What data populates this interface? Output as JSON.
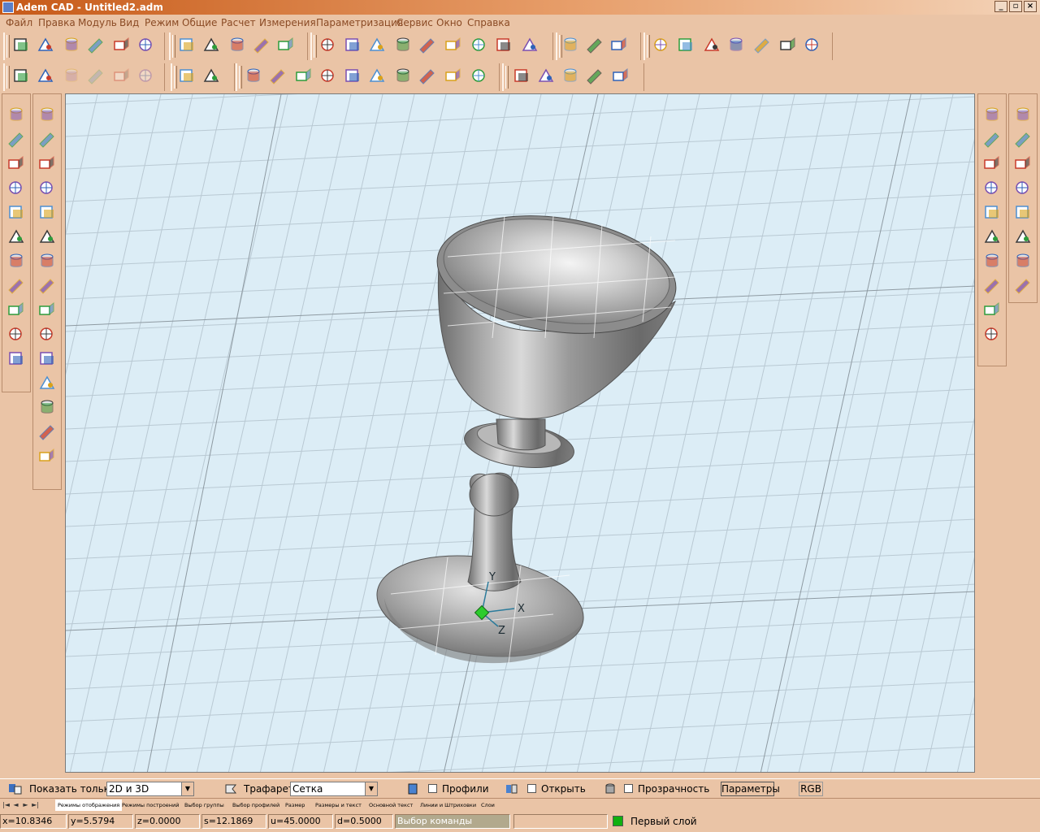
{
  "window": {
    "title": "Adem CAD - Untitled2.adm",
    "controls": [
      "_",
      "▫",
      "×"
    ]
  },
  "menu": [
    "Файл",
    "Правка",
    "Модуль",
    "Вид",
    "Режим",
    "Общие",
    "Расчет",
    "Измерения",
    "Параметризация",
    "Сервис",
    "Окно",
    "Справка"
  ],
  "toolbar1_icons": [
    "new-file-icon",
    "open-folder-icon",
    "save-icon",
    "print-icon",
    "print-preview-icon",
    "copy-files-icon",
    "pencil-sketch-icon",
    "brush-icon",
    "sphere-icon",
    "grid-pattern-icon",
    "hatch-icon",
    "box-solid-icon",
    "box-open-icon",
    "box-pattern-icon",
    "sweep-icon",
    "loft-icon",
    "shell-icon",
    "revolve-icon",
    "chamfer-icon",
    "fillet-icon",
    "cylinder-icon",
    "align-icon",
    "array-icon",
    "import-icon",
    "export-icon",
    "cube-icon",
    "transform-icon",
    "measure-icon",
    "scale-icon",
    "node-grid-icon"
  ],
  "toolbar2_icons": [
    "properties-icon",
    "layers-icon",
    "disabled-save-icon",
    "disabled-tree-icon",
    "disabled-doc-icon",
    "disabled-check-icon",
    "undo-icon",
    "redo-icon",
    "line-icon",
    "rectangle-icon",
    "circle-icon",
    "arc-icon",
    "polyline-icon",
    "spline-icon",
    "curve-icon",
    "bezier-icon",
    "hatch-plane-icon",
    "offset-plane-icon",
    "dimension-linear-icon",
    "dimension-aligned-icon",
    "dimension-radius-icon",
    "dimension-angle-icon",
    "dimension-chain-icon"
  ],
  "left_panel1_icons": [
    "view-rotate-icon",
    "delete-icon",
    "copy-icon",
    "move-icon",
    "rotate-icon",
    "mirror-icon",
    "scale-icon",
    "group-icon",
    "ungroup-icon",
    "select-icon",
    "transfer-icon"
  ],
  "left_panel2_icons": [
    "solid-extrude-icon",
    "solid-cylinder-icon",
    "solid-box-icon",
    "solid-cut-icon",
    "solid-torus-icon",
    "solid-remove-icon",
    "workplane-up-icon",
    "workplane-down-icon",
    "plane-stack-icon",
    "plane-green-icon",
    "plane-orange-icon",
    "sketch-plane-icon",
    "grid-plane-icon",
    "plane-normal-icon",
    "axes-icon"
  ],
  "right_panel1_icons": [
    "line-2d-icon",
    "polygon-icon",
    "circle-2d-icon",
    "angle-icon",
    "trim-icon",
    "extend-icon",
    "intersect-icon",
    "note-icon",
    "checkmark-icon",
    "pattern-icon"
  ],
  "right_panel2_icons": [
    "surface-cut-icon",
    "surface-yellow-icon",
    "surface-fill-icon",
    "surface-highlight-icon",
    "surface-join-icon",
    "surface-sweep-icon",
    "surface-delete-icon",
    "surface-paint-icon"
  ],
  "bottom": {
    "show_only_label": "Показать только",
    "show_only_value": "2D и 3D",
    "stencil_label": "Трафарет",
    "stencil_value": "Сетка",
    "profiles_label": "Профили",
    "open_label": "Открыть",
    "transparency_label": "Прозрачность",
    "params_button": "Параметры",
    "rgb_button": "RGB"
  },
  "tabs": [
    "Режимы отображения",
    "Режимы построений",
    "Выбор группы",
    "Выбор профилей",
    "Размер",
    "Размеры и текст",
    "Основной текст",
    "Линии и Штриховки",
    "Слои"
  ],
  "status": {
    "x": "x=10.8346",
    "y": "y=5.5794",
    "z": "z=0.0000",
    "s": "s=12.1869",
    "u": "u=45.0000",
    "d": "d=0.5000",
    "command": "Выбор команды",
    "layer": "Первый слой",
    "layer_color": "#10b010"
  },
  "axes": {
    "x": "X",
    "y": "Y",
    "z": "Z"
  }
}
